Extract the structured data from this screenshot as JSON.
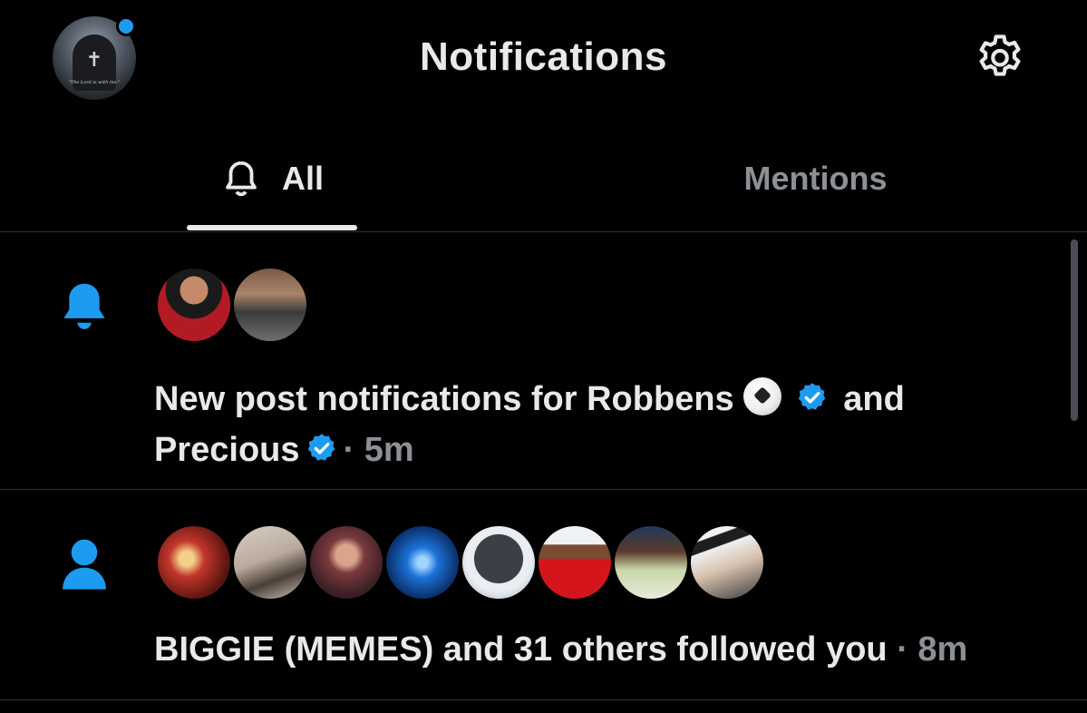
{
  "header": {
    "title": "Notifications",
    "avatar_caption": "\"The Lord is with me.\"",
    "avatar_icon": "hooded-figure-avatar",
    "settings_icon": "gear-icon"
  },
  "tabs": [
    {
      "label": "All",
      "active": true,
      "icon": "bell-outline-icon"
    },
    {
      "label": "Mentions",
      "active": false
    }
  ],
  "colors": {
    "accent": "#1d9bf0",
    "background": "#000000",
    "text": "#e7e9ea",
    "muted": "#8b9096",
    "divider": "#2f3336"
  },
  "notifications": [
    {
      "type": "new-post",
      "icon": "bell-filled-icon",
      "text_prefix": "New post notifications for Robbens",
      "text_joiner": "and",
      "text_name2": "Precious",
      "separator": "·",
      "time": "5m",
      "avatars": [
        "avatar-robbens",
        "avatar-precious"
      ]
    },
    {
      "type": "follow",
      "icon": "person-icon",
      "text": "BIGGIE (MEMES) and 31 others followed you",
      "separator": "·",
      "time": "8m",
      "avatars": [
        "avatar-anime-red",
        "avatar-room",
        "avatar-woman",
        "avatar-eye-pyramid",
        "avatar-angry-ball",
        "avatar-arsenal",
        "avatar-child",
        "avatar-bleach"
      ]
    }
  ]
}
